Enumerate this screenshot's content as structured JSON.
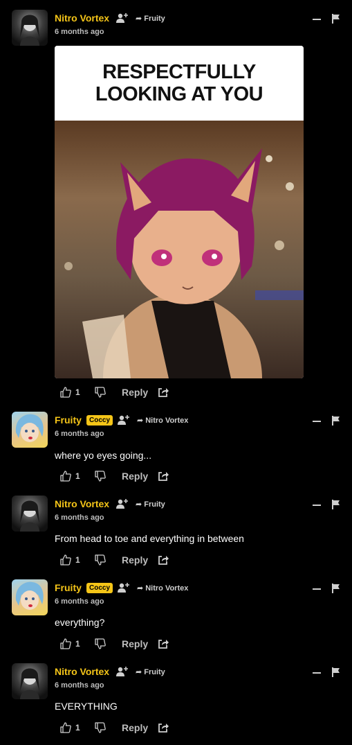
{
  "comments": [
    {
      "author": "Nitro Vortex",
      "badge": "",
      "reply_to": "Fruity",
      "time": "6 months ago",
      "text": "",
      "likes": "1",
      "reply_label": "Reply",
      "meme": {
        "caption_line1": "RESPECTFULLY",
        "caption_line2": "LOOKING AT YOU"
      }
    },
    {
      "author": "Fruity",
      "badge": "Coccy",
      "reply_to": "Nitro Vortex",
      "time": "6 months ago",
      "text": "where yo eyes going...",
      "likes": "1",
      "reply_label": "Reply"
    },
    {
      "author": "Nitro Vortex",
      "badge": "",
      "reply_to": "Fruity",
      "time": "6 months ago",
      "text": "From head to toe and everything in between",
      "likes": "1",
      "reply_label": "Reply"
    },
    {
      "author": "Fruity",
      "badge": "Coccy",
      "reply_to": "Nitro Vortex",
      "time": "6 months ago",
      "text": "everything?",
      "likes": "1",
      "reply_label": "Reply"
    },
    {
      "author": "Nitro Vortex",
      "badge": "",
      "reply_to": "Fruity",
      "time": "6 months ago",
      "text": "EVERYTHING",
      "likes": "1",
      "reply_label": "Reply"
    }
  ],
  "colors": {
    "accent": "#f5c518",
    "background": "#000000",
    "muted": "#bdbdbd"
  },
  "icons": [
    "follow-icon",
    "reply-arrow-icon",
    "minimize-icon",
    "flag-icon",
    "thumbs-up-icon",
    "thumbs-down-icon",
    "share-icon"
  ]
}
